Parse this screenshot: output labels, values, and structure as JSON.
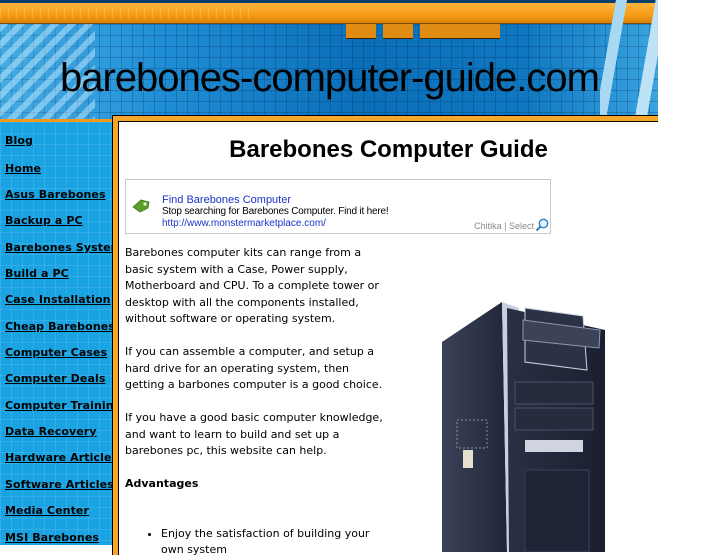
{
  "header": {
    "site_title": "barebones-computer-guide.com"
  },
  "sidebar": {
    "items": [
      {
        "label": "Blog"
      },
      {
        "label": "Home"
      },
      {
        "label": "Asus Barebones"
      },
      {
        "label": "Backup a PC"
      },
      {
        "label": "Barebones System"
      },
      {
        "label": "Build a PC"
      },
      {
        "label": "Case Installation"
      },
      {
        "label": "Cheap Barebones"
      },
      {
        "label": "Computer Cases"
      },
      {
        "label": "Computer Deals"
      },
      {
        "label": "Computer Training"
      },
      {
        "label": "Data Recovery"
      },
      {
        "label": "Hardware Articles"
      },
      {
        "label": "Software Articles"
      },
      {
        "label": "Media Center"
      },
      {
        "label": "MSI Barebones"
      }
    ]
  },
  "main": {
    "title": "Barebones Computer Guide",
    "ad": {
      "title": "Find Barebones Computer",
      "description": "Stop searching for Barebones Computer. Find it here!",
      "url": "http://www.monstermarketplace.com/",
      "brand": "Chitika | Select",
      "icon": "green-tag-icon",
      "brand_icon": "magnifier-icon"
    },
    "paragraphs": [
      "Barebones computer kits can range from a basic system with a Case, Power supply, Motherboard and CPU. To a complete tower or desktop with all the components installed, without software or operating system.",
      "If you can assemble a computer, and setup a hard drive for an operating system, then getting a barbones computer is a good choice.",
      "If you have a good basic computer knowledge, and want to learn to build and set up a barebones pc, this website can help."
    ],
    "advantages_heading": "Advantages",
    "advantages": [
      "Enjoy the satisfaction of building your own system"
    ],
    "image": "barebones-pc-tower-photo"
  },
  "colors": {
    "sidebar_bg": "#1aa3e2",
    "frame_orange": "#f6a629",
    "ad_link": "#1a33c8"
  }
}
